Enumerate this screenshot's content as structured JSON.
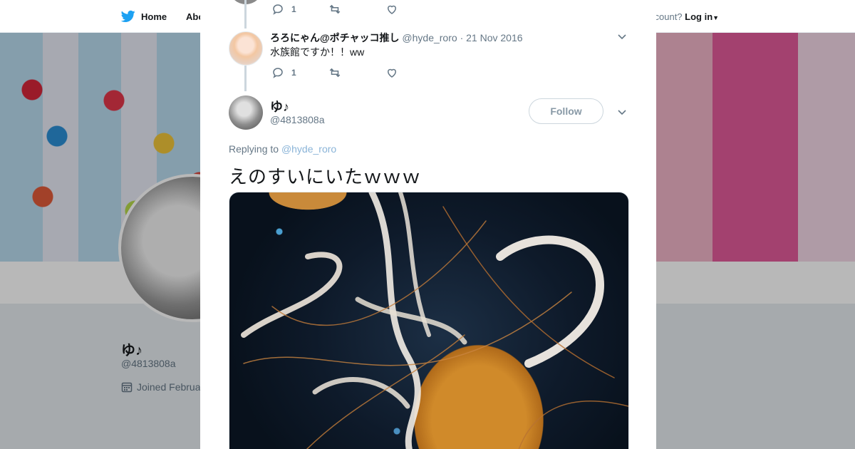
{
  "background": {
    "nav": {
      "home": "Home",
      "about": "Abo",
      "login_prefix": "ccount?",
      "login": "Log in"
    },
    "profile": {
      "name": "ゆ♪",
      "handle": "@4813808a",
      "joined": "Joined Februa"
    }
  },
  "modal": {
    "prev_tweet": {
      "reply_count": "1"
    },
    "reply": {
      "name": "ろろにゃん@ポチャッコ推し",
      "handle": "@hyde_roro",
      "date": "21 Nov 2016",
      "text": "水族館ですか！！ww",
      "reply_count": "1"
    },
    "main": {
      "name": "ゆ♪",
      "handle": "@4813808a",
      "follow": "Follow",
      "replying_label": "Replying to",
      "replying_to": "@hyde_roro",
      "text": "えのすいにいたｗｗｗ"
    }
  },
  "colors": {
    "accent": "#1da1f2",
    "muted": "#657786",
    "line": "#ccd6dd"
  },
  "icons": [
    "twitter-bird-icon",
    "reply-icon",
    "retweet-icon",
    "like-icon",
    "chevron-down-icon",
    "close-icon",
    "calendar-icon",
    "caret-down-icon"
  ]
}
